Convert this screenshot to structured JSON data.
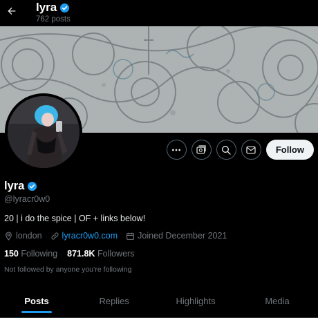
{
  "header": {
    "display_name": "lyra",
    "post_count": "762 posts",
    "verified": true
  },
  "profile": {
    "display_name": "lyra",
    "handle": "@lyracr0w0",
    "bio": "20 | i do the spice | OF + links below!",
    "location": "london",
    "website": "lyracr0w0.com",
    "joined": "Joined December 2021",
    "following_count": "150",
    "following_label": "Following",
    "followers_count": "871.8K",
    "followers_label": "Followers",
    "not_followed_text": "Not followed by anyone you’re following"
  },
  "actions": {
    "follow_label": "Follow"
  },
  "tabs": [
    {
      "label": "Posts",
      "active": true
    },
    {
      "label": "Replies",
      "active": false
    },
    {
      "label": "Highlights",
      "active": false
    },
    {
      "label": "Media",
      "active": false
    }
  ],
  "icons": {
    "back": "arrow-left-icon",
    "verified": "verified-badge-icon",
    "more": "more-icon",
    "subscribe": "subscribe-icon",
    "search": "search-icon",
    "message": "message-icon",
    "location": "location-icon",
    "link": "link-icon",
    "calendar": "calendar-icon"
  },
  "colors": {
    "background": "#000000",
    "accent": "#1d9bf0",
    "muted_text": "#71767b",
    "follow_button_bg": "#eff3f4"
  }
}
